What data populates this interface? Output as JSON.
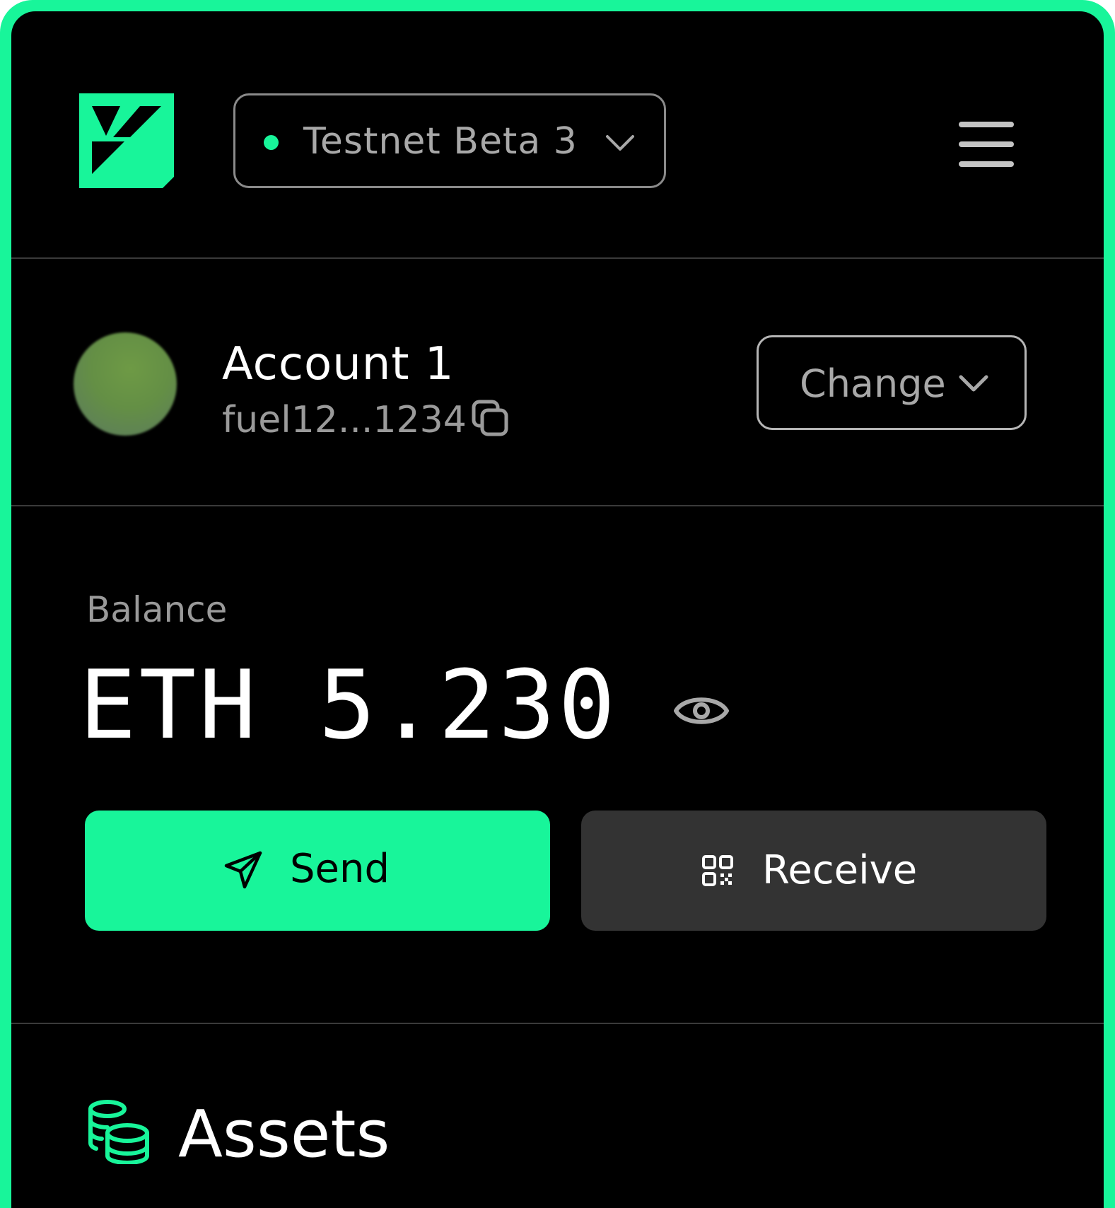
{
  "colors": {
    "accent": "#18f59a",
    "background": "#000000",
    "secondary_button": "#333333",
    "muted_text": "#9a9a9a"
  },
  "header": {
    "logo_icon": "fuel-logo-icon",
    "network": {
      "label": "Testnet Beta 3",
      "status": "connected",
      "icon": "chevron-down-icon"
    },
    "menu_icon": "hamburger-menu-icon"
  },
  "account": {
    "name": "Account 1",
    "address": "fuel12...1234",
    "copy_icon": "copy-icon",
    "change_label": "Change",
    "change_icon": "chevron-down-icon"
  },
  "balance": {
    "label": "Balance",
    "value": "ETH 5.230",
    "visibility_icon": "eye-icon"
  },
  "actions": {
    "send_label": "Send",
    "send_icon": "send-icon",
    "receive_label": "Receive",
    "receive_icon": "qr-code-icon"
  },
  "assets": {
    "title": "Assets",
    "icon": "coins-icon"
  }
}
